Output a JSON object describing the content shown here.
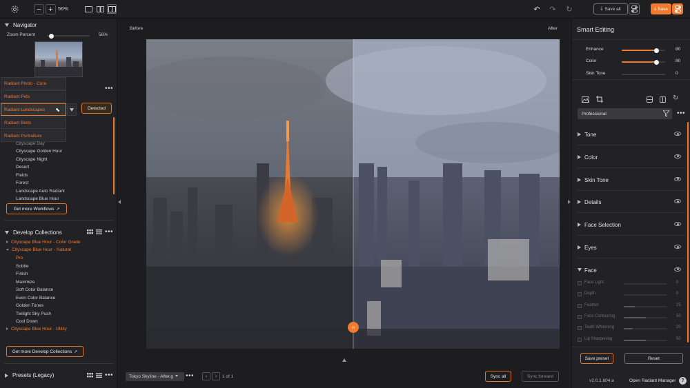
{
  "topbar": {
    "zoom_value": "56%",
    "save_all_label": "Save all",
    "save_label": "Save"
  },
  "navigator": {
    "title": "Navigator",
    "zoom_label": "Zoom Percent",
    "zoom_value": "56%",
    "zoom_fraction": 0.1
  },
  "workflow_dropdown": {
    "items": [
      "Radiant Photo - Core",
      "Radiant Pets",
      "Radiant Landscapes",
      "Radiant Birds",
      "Radiant Portraiture"
    ],
    "detected_label": "Detected"
  },
  "workflows": {
    "items": [
      "Cityscape Day",
      "Cityscape Golden Hour",
      "Cityscape Night",
      "Desert",
      "Fields",
      "Forest",
      "Landscape Auto Radiant",
      "Landscape Blue Hour"
    ],
    "get_more_label": "Get more Workflows"
  },
  "develop": {
    "title": "Develop Collections",
    "collections": [
      {
        "label": "Cityscape Blue Hour - Color Grade"
      },
      {
        "label": "Cityscape Blue Hour - Natural"
      }
    ],
    "sub_items": [
      "Pro",
      "Subtle",
      "Finish",
      "Maximize",
      "Soft Color Balance",
      "Even Color Balance",
      "Golden Tones",
      "Twilight Sky Push",
      "Cool Down"
    ],
    "last_collection": "Cityscape Blue Hour - Utility",
    "get_more_label": "Get more Develop Collections"
  },
  "presets": {
    "title": "Presets (Legacy)"
  },
  "center": {
    "before_label": "Before",
    "after_label": "After",
    "filename": "Tokyo Skyline - After.g",
    "page_info": "1 of 1",
    "sync_all_label": "Sync all",
    "sync_forward_label": "Sync forward"
  },
  "smart": {
    "title": "Smart Editing",
    "sliders": [
      {
        "label": "Enhance",
        "value": "80",
        "fraction": 0.8
      },
      {
        "label": "Color",
        "value": "80",
        "fraction": 0.8
      },
      {
        "label": "Skin Tone",
        "value": "0",
        "fraction": 0
      }
    ],
    "preset_select": "Professional",
    "sections": [
      "Tone",
      "Color",
      "Skin Tone",
      "Details",
      "Face Selection",
      "Eyes",
      "Face"
    ],
    "face_rows": [
      {
        "label": "Face Light",
        "value": "0",
        "fraction": 0
      },
      {
        "label": "Depth",
        "value": "0",
        "fraction": 0
      },
      {
        "label": "Feather",
        "value": "25",
        "fraction": 0.25
      },
      {
        "label": "Face Contouring",
        "value": "50",
        "fraction": 0.5
      },
      {
        "label": "Teeth Whitening",
        "value": "20",
        "fraction": 0.2
      },
      {
        "label": "Lip Sharpening",
        "value": "50",
        "fraction": 0.5
      }
    ],
    "save_preset_label": "Save preset",
    "reset_label": "Reset",
    "version": "v2.0.1.604.a",
    "open_manager_label": "Open Radiant Manager"
  },
  "colors": {
    "accent": "#f07b2d",
    "panel": "#222226",
    "background": "#1d1d20"
  }
}
